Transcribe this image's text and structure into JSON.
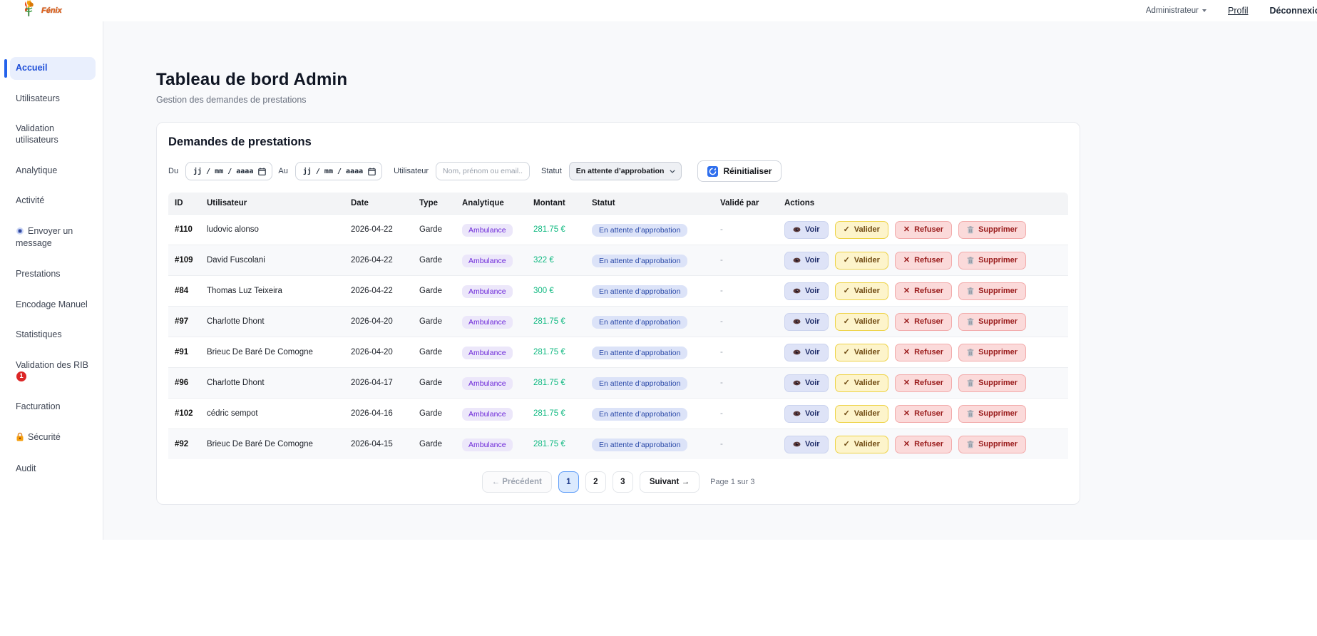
{
  "header": {
    "logo_text": "Fénix",
    "user_menu_label": "Administrateur",
    "profil_label": "Profil",
    "logout_label": "Déconnexion"
  },
  "sidebar": {
    "items": [
      {
        "label": "Accueil",
        "active": true
      },
      {
        "label": "Utilisateurs"
      },
      {
        "label": "Validation utilisateurs"
      },
      {
        "label": "Analytique"
      },
      {
        "label": "Activité"
      },
      {
        "label": "Envoyer un message",
        "icon": "send-message-icon"
      },
      {
        "label": "Prestations"
      },
      {
        "label": "Encodage Manuel"
      },
      {
        "label": "Statistiques"
      },
      {
        "label": "Validation des RIB",
        "badge": "1"
      },
      {
        "label": "Facturation"
      },
      {
        "label": "Sécurité",
        "icon": "lock-icon"
      },
      {
        "label": "Audit"
      }
    ]
  },
  "page": {
    "title": "Tableau de bord Admin",
    "subtitle": "Gestion des demandes de prestations"
  },
  "card": {
    "title": "Demandes de prestations",
    "filters": {
      "du_label": "Du",
      "au_label": "Au",
      "date_placeholder": "jj / mm / aaaa",
      "user_label": "Utilisateur",
      "user_placeholder": "Nom, prénom ou email...",
      "statut_label": "Statut",
      "statut_value": "En attente d’approbation",
      "reset_label": "Réinitialiser"
    },
    "table": {
      "headers": [
        "ID",
        "Utilisateur",
        "Date",
        "Type",
        "Analytique",
        "Montant",
        "Statut",
        "Validé par",
        "Actions"
      ],
      "actions": {
        "voir": "Voir",
        "valider": "Valider",
        "refuser": "Refuser",
        "supprimer": "Supprimer"
      },
      "rows": [
        {
          "id": "#110",
          "user": "ludovic alonso",
          "date": "2026-04-22",
          "type": "Garde",
          "analytique": "Ambulance",
          "montant": "281.75 €",
          "statut": "En attente d’approbation",
          "valide_par": "-"
        },
        {
          "id": "#109",
          "user": "David Fuscolani",
          "date": "2026-04-22",
          "type": "Garde",
          "analytique": "Ambulance",
          "montant": "322 €",
          "statut": "En attente d’approbation",
          "valide_par": "-"
        },
        {
          "id": "#84",
          "user": "Thomas Luz Teixeira",
          "date": "2026-04-22",
          "type": "Garde",
          "analytique": "Ambulance",
          "montant": "300 €",
          "statut": "En attente d’approbation",
          "valide_par": "-"
        },
        {
          "id": "#97",
          "user": "Charlotte Dhont",
          "date": "2026-04-20",
          "type": "Garde",
          "analytique": "Ambulance",
          "montant": "281.75 €",
          "statut": "En attente d’approbation",
          "valide_par": "-"
        },
        {
          "id": "#91",
          "user": "Brieuc De Baré De Comogne",
          "date": "2026-04-20",
          "type": "Garde",
          "analytique": "Ambulance",
          "montant": "281.75 €",
          "statut": "En attente d’approbation",
          "valide_par": "-"
        },
        {
          "id": "#96",
          "user": "Charlotte Dhont",
          "date": "2026-04-17",
          "type": "Garde",
          "analytique": "Ambulance",
          "montant": "281.75 €",
          "statut": "En attente d’approbation",
          "valide_par": "-"
        },
        {
          "id": "#102",
          "user": "cédric sempot",
          "date": "2026-04-16",
          "type": "Garde",
          "analytique": "Ambulance",
          "montant": "281.75 €",
          "statut": "En attente d’approbation",
          "valide_par": "-"
        },
        {
          "id": "#92",
          "user": "Brieuc De Baré De Comogne",
          "date": "2026-04-15",
          "type": "Garde",
          "analytique": "Ambulance",
          "montant": "281.75 €",
          "statut": "En attente d’approbation",
          "valide_par": "-"
        }
      ]
    },
    "pagination": {
      "prev_label": "← Précédent",
      "pages": [
        "1",
        "2",
        "3"
      ],
      "active_page": "1",
      "next_label": "Suivant →",
      "info": "Page 1 sur 3"
    }
  },
  "colors": {
    "accent_blue": "#2563eb",
    "montant_green": "#10b981",
    "analytique_purple": "#6d28d9",
    "statut_blue": "#2b4aa8",
    "danger_red": "#991b1b",
    "valider_yellow": "#6f4a12",
    "badge_red": "#dc2626"
  }
}
